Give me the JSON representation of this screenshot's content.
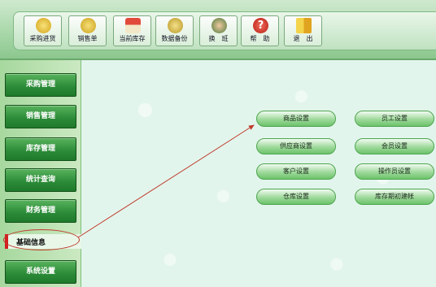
{
  "toolbar": {
    "buttons": [
      {
        "label": "采购进货",
        "icon": "purchase-icon"
      },
      {
        "label": "销售单",
        "icon": "sales-icon"
      },
      {
        "label": "当前库存",
        "icon": "house-icon"
      },
      {
        "label": "数据备份",
        "icon": "backup-icon"
      },
      {
        "label": "换　班",
        "icon": "users-icon"
      },
      {
        "label": "帮　助",
        "icon": "help-icon"
      },
      {
        "label": "退　出",
        "icon": "exit-icon"
      }
    ]
  },
  "sidebar": {
    "items": [
      {
        "label": "采购管理"
      },
      {
        "label": "销售管理"
      },
      {
        "label": "库存管理"
      },
      {
        "label": "统计查询"
      },
      {
        "label": "财务管理"
      },
      {
        "label": "基础信息"
      },
      {
        "label": "系统设置"
      }
    ],
    "selected_index": 5
  },
  "main": {
    "buttons": [
      {
        "label": "商品设置"
      },
      {
        "label": "员工设置"
      },
      {
        "label": "供应商设置"
      },
      {
        "label": "会员设置"
      },
      {
        "label": "客户设置"
      },
      {
        "label": "操作员设置"
      },
      {
        "label": "仓库设置"
      },
      {
        "label": "库存期初建帐"
      }
    ]
  },
  "colors": {
    "accent_red": "#d21f1f",
    "sidebar_green": "#2a8a37",
    "pill_green": "#9ed99b"
  }
}
